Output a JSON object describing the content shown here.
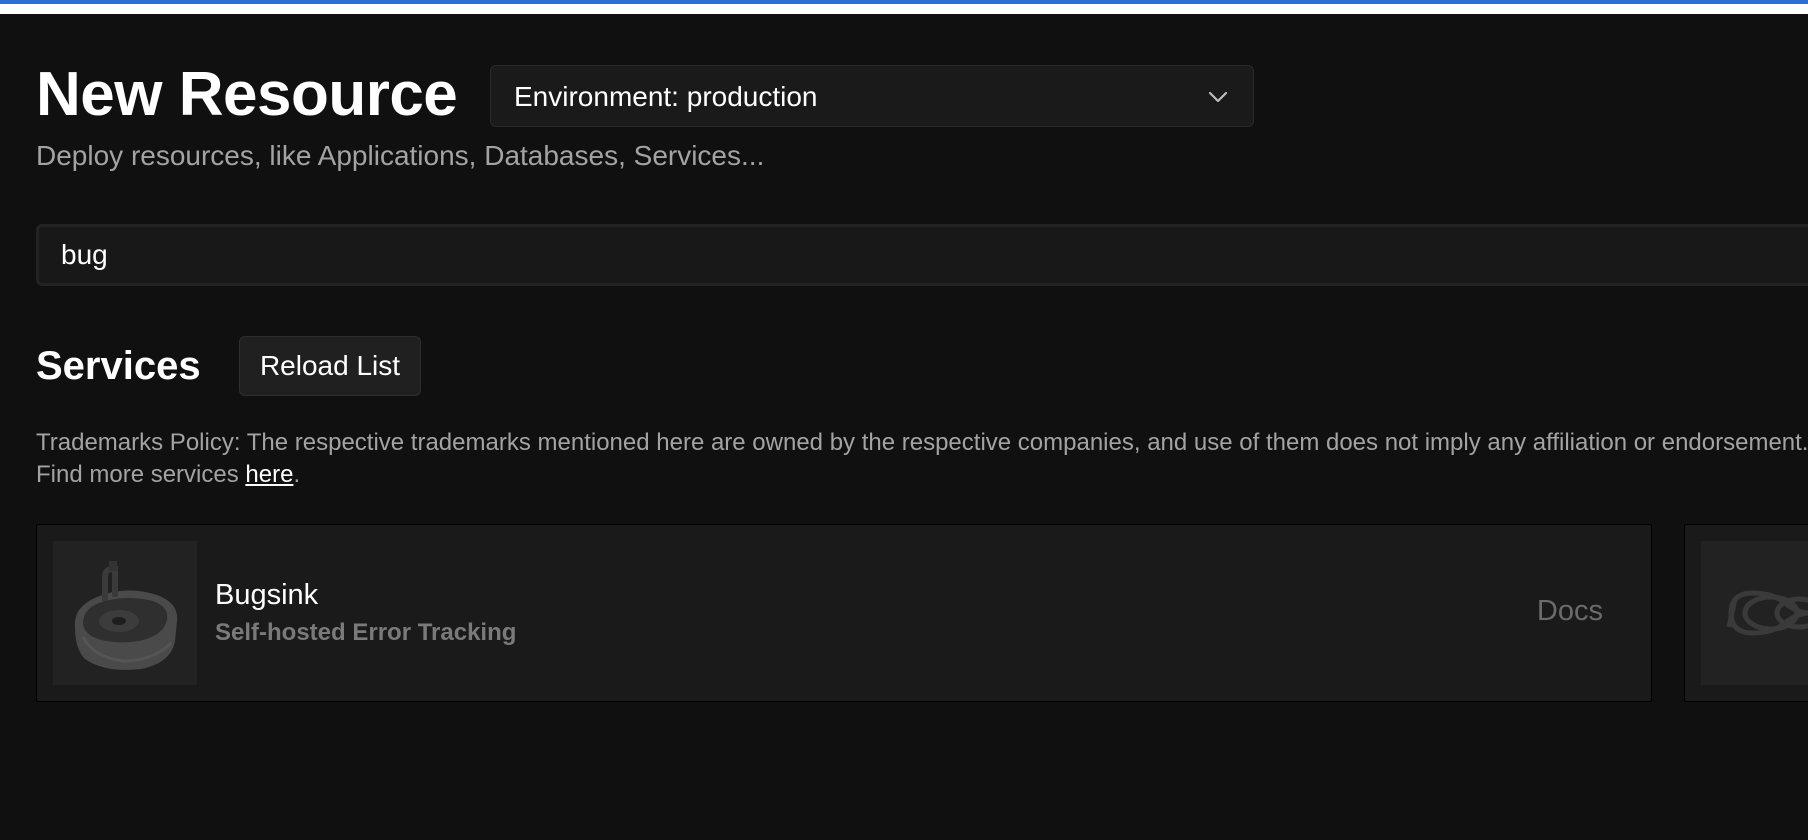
{
  "header": {
    "title": "New Resource",
    "subtitle": "Deploy resources, like Applications, Databases, Services..."
  },
  "environment_select": {
    "label": "Environment: production",
    "icon": "chevron-down-icon"
  },
  "search": {
    "value": "bug"
  },
  "services": {
    "heading": "Services",
    "reload_label": "Reload List",
    "policy_text": "Trademarks Policy: The respective trademarks mentioned here are owned by the respective companies, and use of them does not imply any affiliation or endorsement.",
    "find_more_prefix": "Find more services ",
    "find_more_link": "here",
    "find_more_suffix": "."
  },
  "results": [
    {
      "name": "Bugsink",
      "description": "Self-hosted Error Tracking",
      "docs_label": "Docs",
      "icon": "bugsink-sink-logo-icon"
    },
    {
      "icon": "knot-logo-icon"
    }
  ],
  "colors": {
    "accent": "#2b6fd6",
    "background": "#101010",
    "card": "#1a1a1a",
    "muted_text": "#a3a3a3"
  }
}
